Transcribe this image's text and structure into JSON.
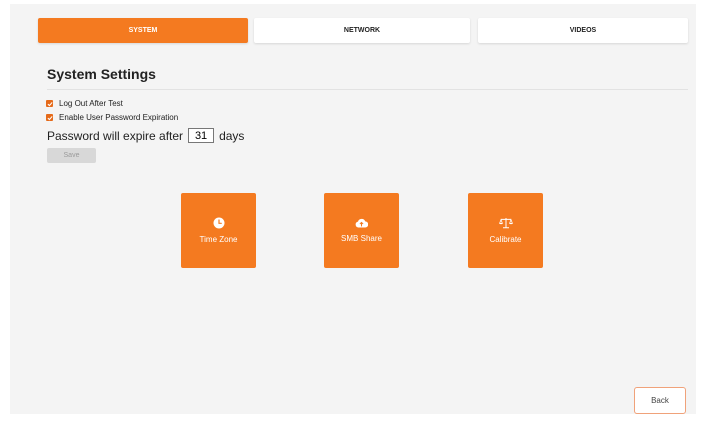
{
  "tabs": [
    {
      "label": "SYSTEM",
      "active": true
    },
    {
      "label": "NETWORK",
      "active": false
    },
    {
      "label": "VIDEOS",
      "active": false
    }
  ],
  "settings": {
    "title": "System Settings",
    "logout_label": "Log Out After Test",
    "logout_checked": true,
    "expiration_label": "Enable User Password Expiration",
    "expiration_checked": true,
    "expire_prefix": "Password will expire after",
    "expire_days": "31",
    "expire_suffix": "days",
    "save_label": "Save"
  },
  "tiles": [
    {
      "label": "Time Zone",
      "icon": "clock-icon"
    },
    {
      "label": "SMB Share",
      "icon": "cloud-upload-icon"
    },
    {
      "label": "Calibrate",
      "icon": "scale-icon"
    }
  ],
  "back_label": "Back",
  "colors": {
    "accent": "#f47a20",
    "checkbox": "#e56a1a",
    "background": "#f4f4f4"
  }
}
